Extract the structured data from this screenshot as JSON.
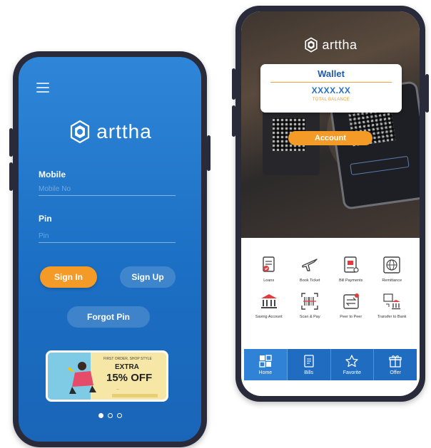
{
  "login_screen": {
    "brand": "arttha",
    "mobile_label": "Mobile",
    "mobile_placeholder": "Mobile No",
    "pin_label": "Pin",
    "pin_placeholder": "Pin",
    "sign_in_label": "Sign In",
    "sign_up_label": "Sign Up",
    "forgot_pin_label": "Forgot Pin",
    "banner": {
      "tagline": "FIRST ORDER, SHOP STYLE",
      "extra": "EXTRA",
      "offer": "15% OFF",
      "fine_print": "—",
      "code": "USE CODE AT CHECKOUT"
    },
    "carousel": {
      "count": 3,
      "active": 0
    }
  },
  "wallet_screen": {
    "brand": "arttha",
    "wallet_title": "Wallet",
    "balance": "XXXX.XX",
    "balance_caption": "TOTAL BALANCE",
    "account_button": "Account",
    "services": [
      {
        "label": "Loans",
        "icon": "loan-document-icon"
      },
      {
        "label": "Book Ticket",
        "icon": "airplane-icon"
      },
      {
        "label": "Bill Payments",
        "icon": "bill-icon"
      },
      {
        "label": "Remittance",
        "icon": "globe-icon"
      },
      {
        "label": "Saving Account",
        "icon": "bank-icon"
      },
      {
        "label": "Scan & Pay",
        "icon": "barcode-icon"
      },
      {
        "label": "Peer to Peer",
        "icon": "transfer-arrows-icon"
      },
      {
        "label": "Transfer to Bank",
        "icon": "bank-transfer-icon"
      }
    ],
    "tabs": [
      {
        "label": "Home",
        "icon": "home-grid-icon"
      },
      {
        "label": "Bills",
        "icon": "bills-icon"
      },
      {
        "label": "Favorite",
        "icon": "star-icon"
      },
      {
        "label": "Offer",
        "icon": "gift-icon"
      }
    ],
    "active_tab": 0
  },
  "colors": {
    "primary_blue": "#1b6fc4",
    "accent_orange": "#f39a27",
    "frame": "#2a2b3a"
  }
}
